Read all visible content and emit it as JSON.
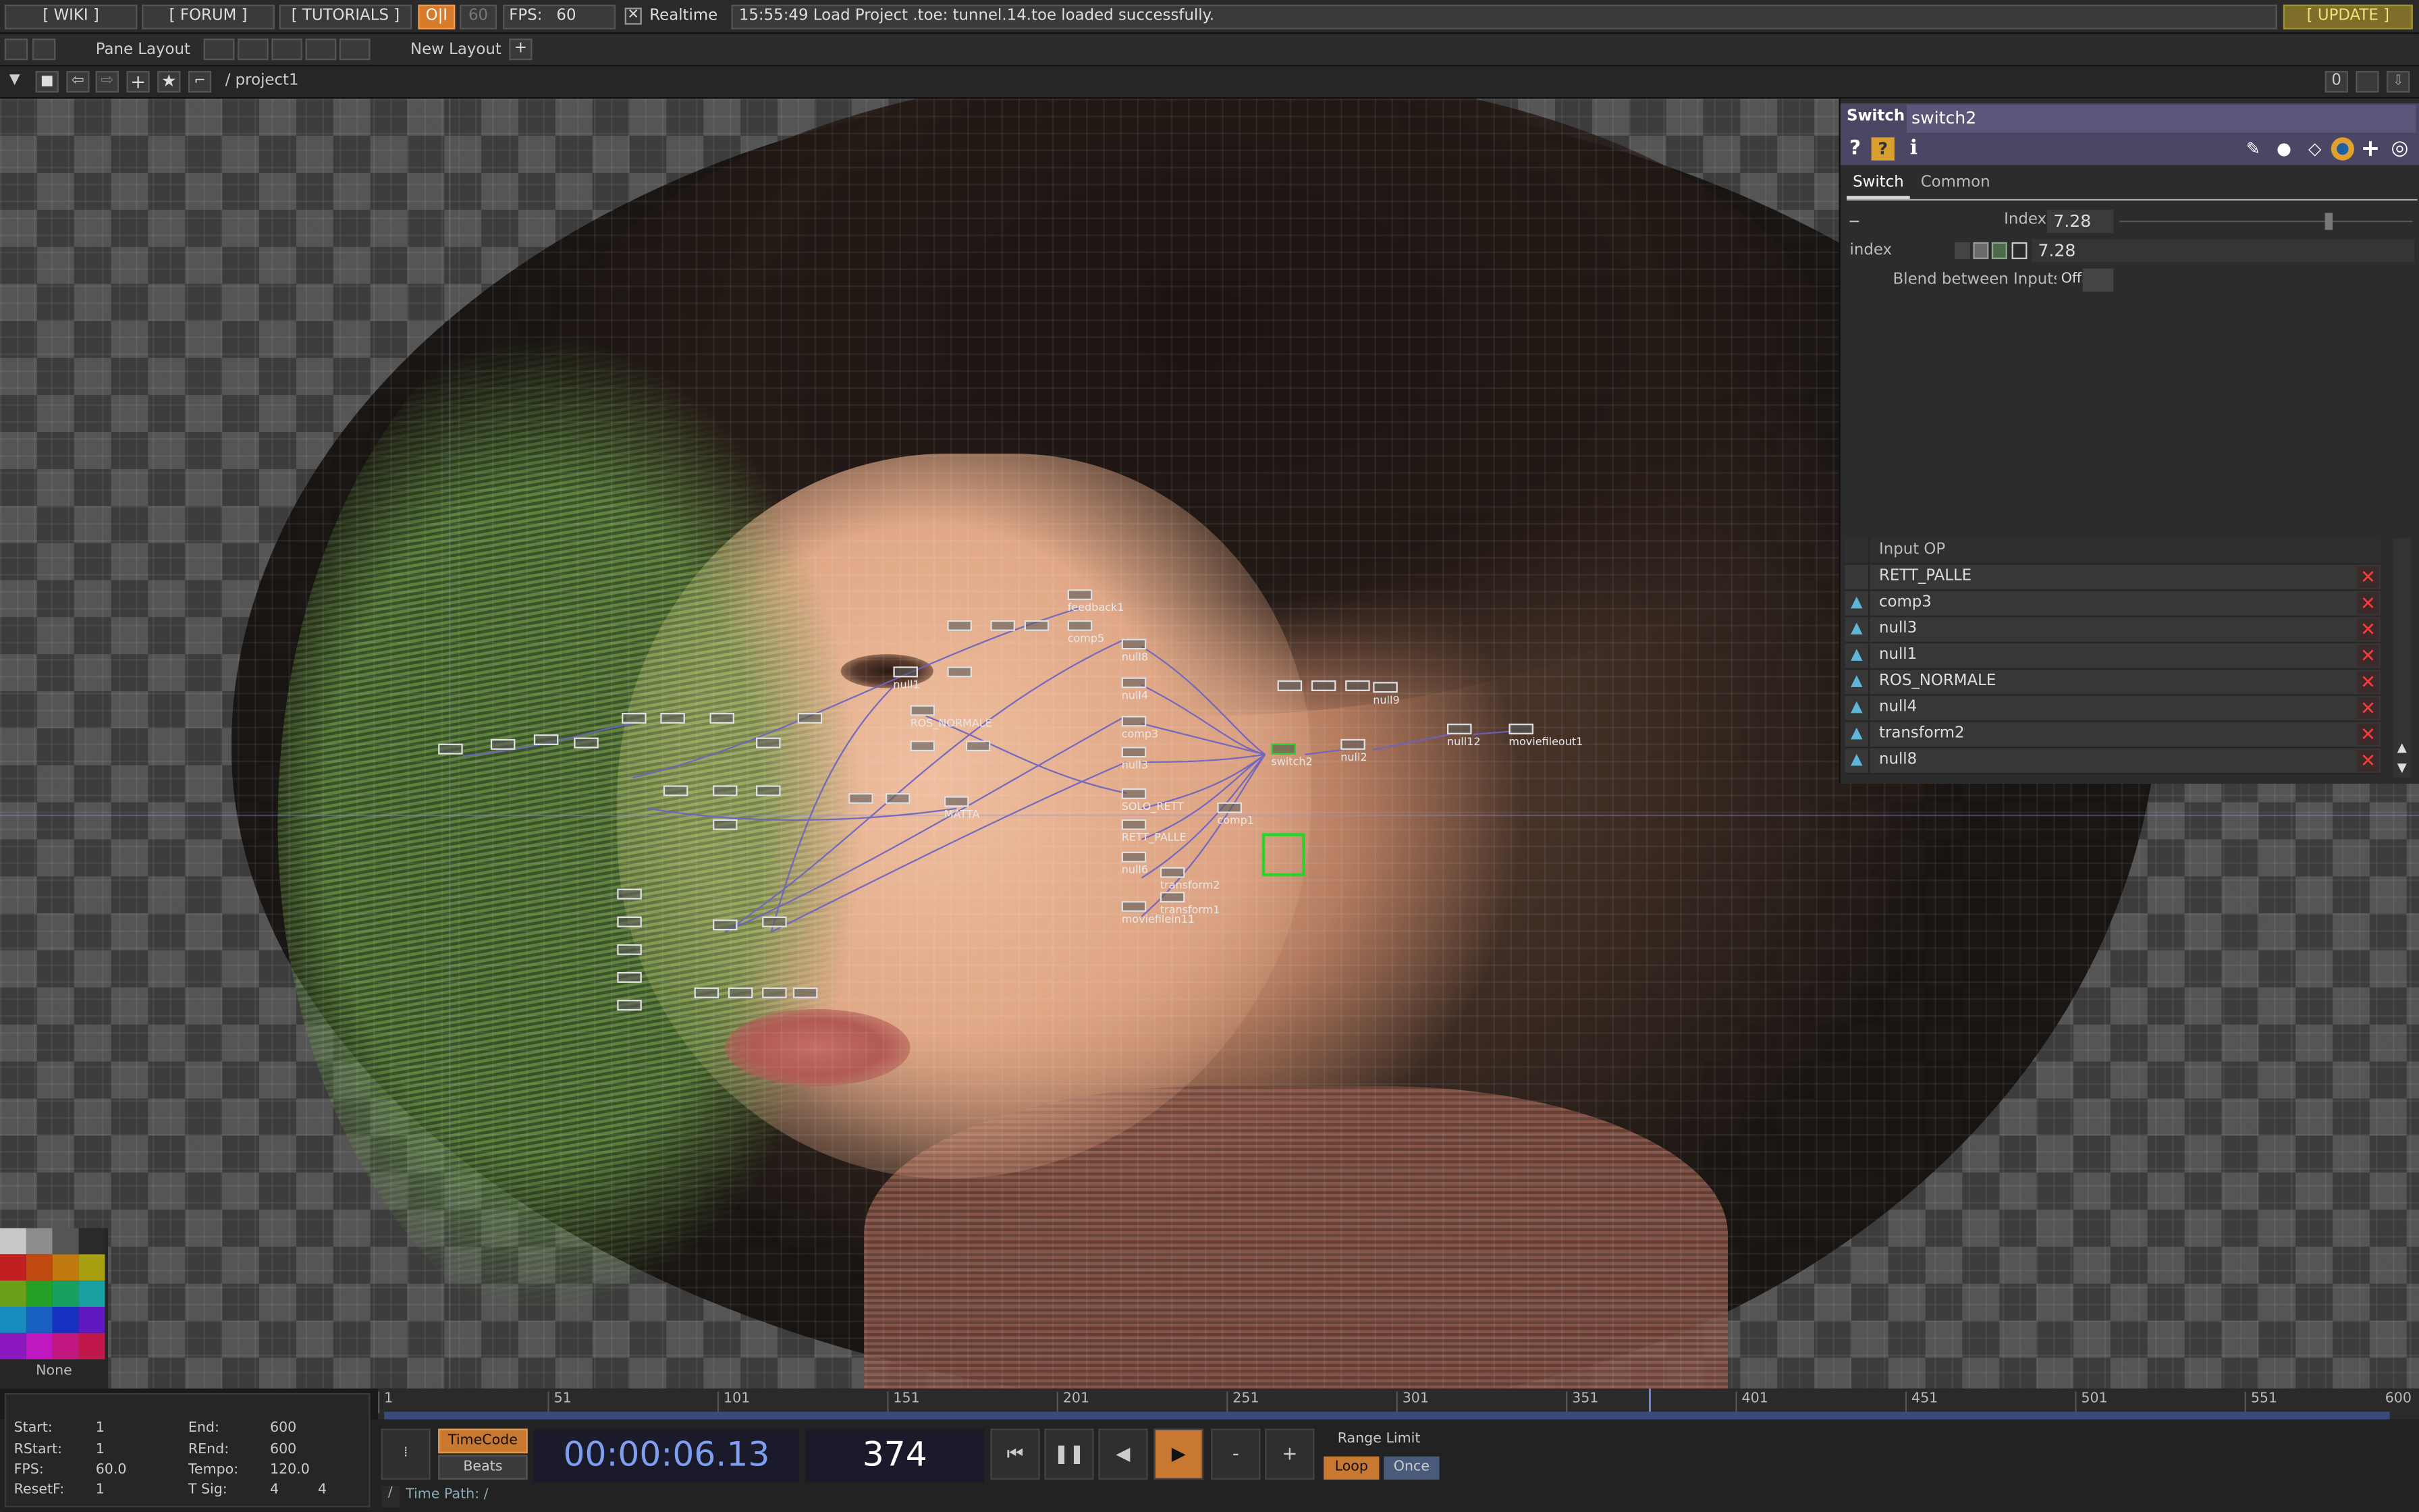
{
  "topbar": {
    "wiki": "[ WIKI ]",
    "forum": "[ FORUM ]",
    "tutorials": "[ TUTORIALS ]",
    "oi": "O|I",
    "sixty": "60",
    "fps_label": "FPS:",
    "fps_value": "60",
    "realtime": "Realtime",
    "message": "15:55:49 Load Project .toe: tunnel.14.toe loaded successfully.",
    "update": "[ UPDATE ]"
  },
  "bar2": {
    "pane_layout": "Pane Layout",
    "new_layout": "New Layout",
    "plus": "+"
  },
  "bar3": {
    "path": "/ project1",
    "counter": "0"
  },
  "nodes": [
    {
      "label": "feedback1"
    },
    {
      "label": "comp5"
    },
    {
      "label": "null8"
    },
    {
      "label": "null4"
    },
    {
      "label": "comp3"
    },
    {
      "label": "null3"
    },
    {
      "label": "SOLO_RETT"
    },
    {
      "label": "RETT_PALLE"
    },
    {
      "label": "comp1"
    },
    {
      "label": "null6"
    },
    {
      "label": "transform2"
    },
    {
      "label": "transform1"
    },
    {
      "label": "moviefilein11"
    },
    {
      "label": "switch2"
    },
    {
      "label": "null2"
    },
    {
      "label": "null12"
    },
    {
      "label": "moviefileout1"
    },
    {
      "label": "null9"
    },
    {
      "label": "ROS_NORMALE"
    },
    {
      "label": "MATTA"
    },
    {
      "label": "null1"
    }
  ],
  "panel": {
    "type": "Switch",
    "name": "switch2",
    "tab_switch": "Switch",
    "tab_common": "Common",
    "index_label": "Index",
    "index_value": "7.28",
    "expr_label": "index",
    "expr_value": "7.28",
    "blend_label": "Blend between Inputs",
    "blend_value": "Off",
    "table_header": "Input OP",
    "inputs": [
      "RETT_PALLE",
      "comp3",
      "null3",
      "null1",
      "ROS_NORMALE",
      "null4",
      "transform2",
      "null8"
    ]
  },
  "palette": {
    "none_label": "None",
    "colors": [
      "#c8c8c8",
      "#8c8c8c",
      "#555555",
      "#2a2a2a",
      "#c02020",
      "#c04a10",
      "#c07a10",
      "#a8a010",
      "#6ca018",
      "#24a024",
      "#18a060",
      "#18a0a0",
      "#188cc0",
      "#1860c0",
      "#1830c0",
      "#6018c0",
      "#8c18c0",
      "#c018c0",
      "#c01880",
      "#c0184a"
    ]
  },
  "timeline": {
    "ticks": [
      "1",
      "51",
      "101",
      "151",
      "201",
      "251",
      "301",
      "351",
      "401",
      "451",
      "501",
      "551",
      "600"
    ],
    "timecode": "TimeCode",
    "beats": "Beats",
    "time": "00:00:06.13",
    "frame": "374",
    "range_limit": "Range Limit",
    "loop": "Loop",
    "once": "Once",
    "time_path": "Time Path: /",
    "slash": "/"
  },
  "stats": {
    "start_l": "Start:",
    "start_v": "1",
    "end_l": "End:",
    "end_v": "600",
    "rstart_l": "RStart:",
    "rstart_v": "1",
    "rend_l": "REnd:",
    "rend_v": "600",
    "fps_l": "FPS:",
    "fps_v": "60.0",
    "tempo_l": "Tempo:",
    "tempo_v": "120.0",
    "resetf_l": "ResetF:",
    "resetf_v": "1",
    "tsig_l": "T Sig:",
    "tsig_v1": "4",
    "tsig_v2": "4"
  },
  "colors": {
    "accent": "#e07a2a",
    "selection": "#2bd22b",
    "panel_header": "#4b4664",
    "delete": "#ff3a3a"
  }
}
